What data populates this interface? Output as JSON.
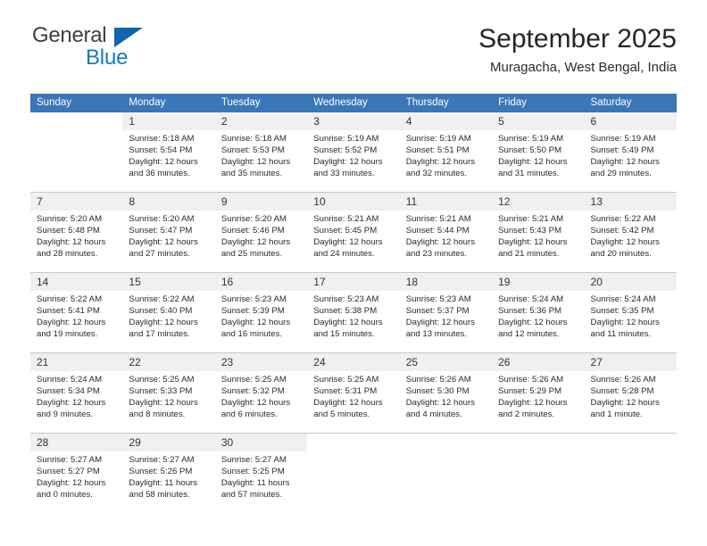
{
  "brand": {
    "name_top": "General",
    "name_bottom": "Blue",
    "triangle_color": "#1464ab",
    "blue_color": "#1479c4"
  },
  "header": {
    "title": "September 2025",
    "subtitle": "Muragacha, West Bengal, India"
  },
  "colors": {
    "header_row_bg": "#3a76b8",
    "day_number_bg": "#f0f0f0",
    "row_divider": "#c8c8c8"
  },
  "weekday_headers": [
    "Sunday",
    "Monday",
    "Tuesday",
    "Wednesday",
    "Thursday",
    "Friday",
    "Saturday"
  ],
  "weeks": [
    [
      {
        "day": "",
        "sunrise": "",
        "sunset": "",
        "daylight_line1": "",
        "daylight_line2": ""
      },
      {
        "day": "1",
        "sunrise": "Sunrise: 5:18 AM",
        "sunset": "Sunset: 5:54 PM",
        "daylight_line1": "Daylight: 12 hours",
        "daylight_line2": "and 36 minutes."
      },
      {
        "day": "2",
        "sunrise": "Sunrise: 5:18 AM",
        "sunset": "Sunset: 5:53 PM",
        "daylight_line1": "Daylight: 12 hours",
        "daylight_line2": "and 35 minutes."
      },
      {
        "day": "3",
        "sunrise": "Sunrise: 5:19 AM",
        "sunset": "Sunset: 5:52 PM",
        "daylight_line1": "Daylight: 12 hours",
        "daylight_line2": "and 33 minutes."
      },
      {
        "day": "4",
        "sunrise": "Sunrise: 5:19 AM",
        "sunset": "Sunset: 5:51 PM",
        "daylight_line1": "Daylight: 12 hours",
        "daylight_line2": "and 32 minutes."
      },
      {
        "day": "5",
        "sunrise": "Sunrise: 5:19 AM",
        "sunset": "Sunset: 5:50 PM",
        "daylight_line1": "Daylight: 12 hours",
        "daylight_line2": "and 31 minutes."
      },
      {
        "day": "6",
        "sunrise": "Sunrise: 5:19 AM",
        "sunset": "Sunset: 5:49 PM",
        "daylight_line1": "Daylight: 12 hours",
        "daylight_line2": "and 29 minutes."
      }
    ],
    [
      {
        "day": "7",
        "sunrise": "Sunrise: 5:20 AM",
        "sunset": "Sunset: 5:48 PM",
        "daylight_line1": "Daylight: 12 hours",
        "daylight_line2": "and 28 minutes."
      },
      {
        "day": "8",
        "sunrise": "Sunrise: 5:20 AM",
        "sunset": "Sunset: 5:47 PM",
        "daylight_line1": "Daylight: 12 hours",
        "daylight_line2": "and 27 minutes."
      },
      {
        "day": "9",
        "sunrise": "Sunrise: 5:20 AM",
        "sunset": "Sunset: 5:46 PM",
        "daylight_line1": "Daylight: 12 hours",
        "daylight_line2": "and 25 minutes."
      },
      {
        "day": "10",
        "sunrise": "Sunrise: 5:21 AM",
        "sunset": "Sunset: 5:45 PM",
        "daylight_line1": "Daylight: 12 hours",
        "daylight_line2": "and 24 minutes."
      },
      {
        "day": "11",
        "sunrise": "Sunrise: 5:21 AM",
        "sunset": "Sunset: 5:44 PM",
        "daylight_line1": "Daylight: 12 hours",
        "daylight_line2": "and 23 minutes."
      },
      {
        "day": "12",
        "sunrise": "Sunrise: 5:21 AM",
        "sunset": "Sunset: 5:43 PM",
        "daylight_line1": "Daylight: 12 hours",
        "daylight_line2": "and 21 minutes."
      },
      {
        "day": "13",
        "sunrise": "Sunrise: 5:22 AM",
        "sunset": "Sunset: 5:42 PM",
        "daylight_line1": "Daylight: 12 hours",
        "daylight_line2": "and 20 minutes."
      }
    ],
    [
      {
        "day": "14",
        "sunrise": "Sunrise: 5:22 AM",
        "sunset": "Sunset: 5:41 PM",
        "daylight_line1": "Daylight: 12 hours",
        "daylight_line2": "and 19 minutes."
      },
      {
        "day": "15",
        "sunrise": "Sunrise: 5:22 AM",
        "sunset": "Sunset: 5:40 PM",
        "daylight_line1": "Daylight: 12 hours",
        "daylight_line2": "and 17 minutes."
      },
      {
        "day": "16",
        "sunrise": "Sunrise: 5:23 AM",
        "sunset": "Sunset: 5:39 PM",
        "daylight_line1": "Daylight: 12 hours",
        "daylight_line2": "and 16 minutes."
      },
      {
        "day": "17",
        "sunrise": "Sunrise: 5:23 AM",
        "sunset": "Sunset: 5:38 PM",
        "daylight_line1": "Daylight: 12 hours",
        "daylight_line2": "and 15 minutes."
      },
      {
        "day": "18",
        "sunrise": "Sunrise: 5:23 AM",
        "sunset": "Sunset: 5:37 PM",
        "daylight_line1": "Daylight: 12 hours",
        "daylight_line2": "and 13 minutes."
      },
      {
        "day": "19",
        "sunrise": "Sunrise: 5:24 AM",
        "sunset": "Sunset: 5:36 PM",
        "daylight_line1": "Daylight: 12 hours",
        "daylight_line2": "and 12 minutes."
      },
      {
        "day": "20",
        "sunrise": "Sunrise: 5:24 AM",
        "sunset": "Sunset: 5:35 PM",
        "daylight_line1": "Daylight: 12 hours",
        "daylight_line2": "and 11 minutes."
      }
    ],
    [
      {
        "day": "21",
        "sunrise": "Sunrise: 5:24 AM",
        "sunset": "Sunset: 5:34 PM",
        "daylight_line1": "Daylight: 12 hours",
        "daylight_line2": "and 9 minutes."
      },
      {
        "day": "22",
        "sunrise": "Sunrise: 5:25 AM",
        "sunset": "Sunset: 5:33 PM",
        "daylight_line1": "Daylight: 12 hours",
        "daylight_line2": "and 8 minutes."
      },
      {
        "day": "23",
        "sunrise": "Sunrise: 5:25 AM",
        "sunset": "Sunset: 5:32 PM",
        "daylight_line1": "Daylight: 12 hours",
        "daylight_line2": "and 6 minutes."
      },
      {
        "day": "24",
        "sunrise": "Sunrise: 5:25 AM",
        "sunset": "Sunset: 5:31 PM",
        "daylight_line1": "Daylight: 12 hours",
        "daylight_line2": "and 5 minutes."
      },
      {
        "day": "25",
        "sunrise": "Sunrise: 5:26 AM",
        "sunset": "Sunset: 5:30 PM",
        "daylight_line1": "Daylight: 12 hours",
        "daylight_line2": "and 4 minutes."
      },
      {
        "day": "26",
        "sunrise": "Sunrise: 5:26 AM",
        "sunset": "Sunset: 5:29 PM",
        "daylight_line1": "Daylight: 12 hours",
        "daylight_line2": "and 2 minutes."
      },
      {
        "day": "27",
        "sunrise": "Sunrise: 5:26 AM",
        "sunset": "Sunset: 5:28 PM",
        "daylight_line1": "Daylight: 12 hours",
        "daylight_line2": "and 1 minute."
      }
    ],
    [
      {
        "day": "28",
        "sunrise": "Sunrise: 5:27 AM",
        "sunset": "Sunset: 5:27 PM",
        "daylight_line1": "Daylight: 12 hours",
        "daylight_line2": "and 0 minutes."
      },
      {
        "day": "29",
        "sunrise": "Sunrise: 5:27 AM",
        "sunset": "Sunset: 5:26 PM",
        "daylight_line1": "Daylight: 11 hours",
        "daylight_line2": "and 58 minutes."
      },
      {
        "day": "30",
        "sunrise": "Sunrise: 5:27 AM",
        "sunset": "Sunset: 5:25 PM",
        "daylight_line1": "Daylight: 11 hours",
        "daylight_line2": "and 57 minutes."
      },
      {
        "day": "",
        "sunrise": "",
        "sunset": "",
        "daylight_line1": "",
        "daylight_line2": ""
      },
      {
        "day": "",
        "sunrise": "",
        "sunset": "",
        "daylight_line1": "",
        "daylight_line2": ""
      },
      {
        "day": "",
        "sunrise": "",
        "sunset": "",
        "daylight_line1": "",
        "daylight_line2": ""
      },
      {
        "day": "",
        "sunrise": "",
        "sunset": "",
        "daylight_line1": "",
        "daylight_line2": ""
      }
    ]
  ]
}
